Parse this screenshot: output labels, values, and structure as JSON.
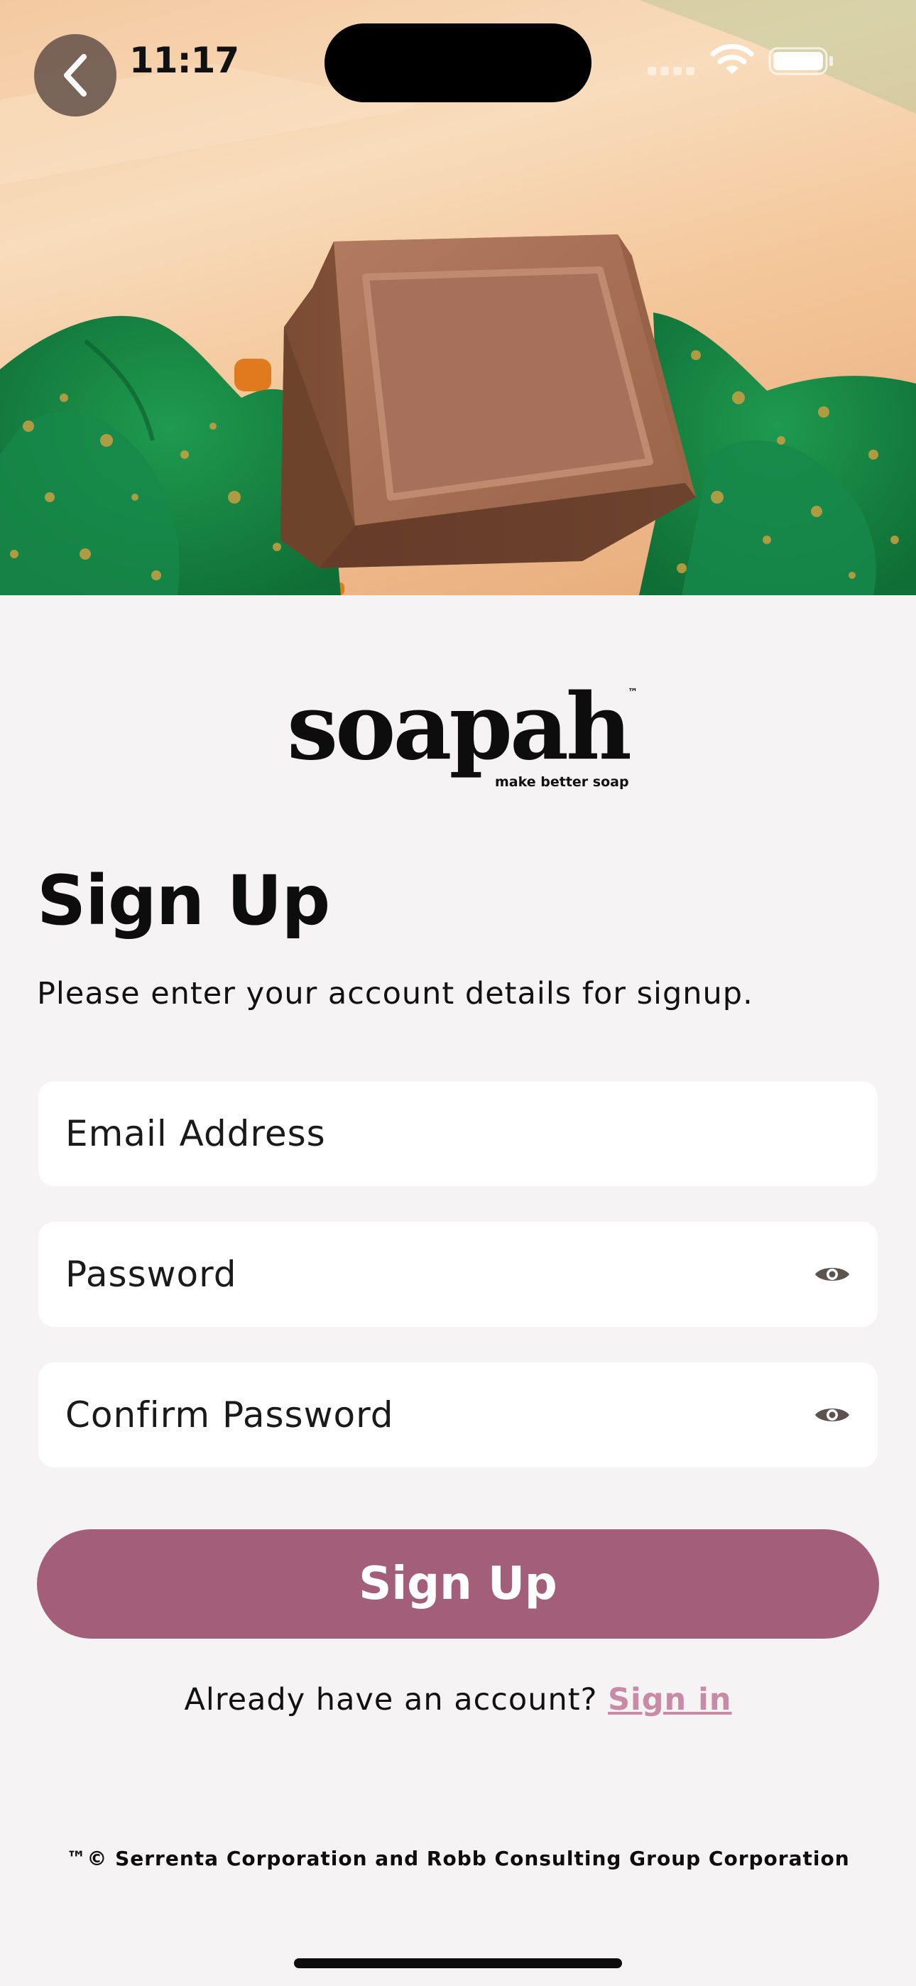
{
  "status_bar": {
    "time": "11:17"
  },
  "hero": {
    "image": "soap-bar-on-green-tissue-paper"
  },
  "brand": {
    "logo_text": "soapah",
    "trademark": "™",
    "tagline": "make better soap"
  },
  "form": {
    "title": "Sign Up",
    "subtitle": "Please enter your account details for signup.",
    "email_placeholder": "Email Address",
    "password_placeholder": "Password",
    "confirm_password_placeholder": "Confirm Password",
    "submit_label": "Sign Up"
  },
  "signin": {
    "prompt": "Already have an account?",
    "link_label": "Sign in"
  },
  "footer": {
    "text": "™© Serrenta Corporation and Robb Consulting Group Corporation"
  },
  "colors": {
    "primary_button": "#a35e79",
    "link": "#c98aa6",
    "background": "#f5f3f4"
  },
  "icons": [
    "back-chevron-icon",
    "signal-icon",
    "wifi-icon",
    "battery-icon",
    "eye-icon"
  ]
}
